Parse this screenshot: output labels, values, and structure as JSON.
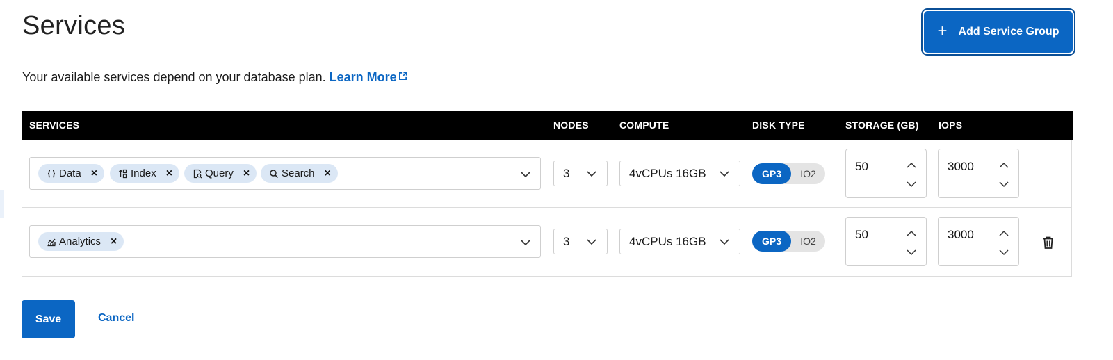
{
  "page": {
    "title": "Services",
    "add_button_label": "Add Service Group",
    "description": "Your available services depend on your database plan.",
    "learn_more_label": "Learn More"
  },
  "table": {
    "headers": {
      "services": "SERVICES",
      "nodes": "NODES",
      "compute": "COMPUTE",
      "disk_type": "DISK TYPE",
      "storage": "STORAGE (GB)",
      "iops": "IOPS"
    },
    "rows": [
      {
        "services": [
          {
            "label": "Data",
            "icon": "braces-icon"
          },
          {
            "label": "Index",
            "icon": "index-sort-icon"
          },
          {
            "label": "Query",
            "icon": "query-document-icon"
          },
          {
            "label": "Search",
            "icon": "search-icon"
          }
        ],
        "nodes": "3",
        "compute": "4vCPUs 16GB",
        "disk_type_options": [
          "GP3",
          "IO2"
        ],
        "disk_type_selected": "GP3",
        "storage": "50",
        "iops": "3000"
      },
      {
        "services": [
          {
            "label": "Analytics",
            "icon": "analytics-chart-icon"
          }
        ],
        "nodes": "3",
        "compute": "4vCPUs 16GB",
        "disk_type_options": [
          "GP3",
          "IO2"
        ],
        "disk_type_selected": "GP3",
        "storage": "50",
        "iops": "3000",
        "deletable": true
      }
    ]
  },
  "actions": {
    "save_label": "Save",
    "cancel_label": "Cancel"
  },
  "colors": {
    "accent": "#0b66c3",
    "header_bg": "#000000",
    "chip_bg": "#dbe7f5",
    "toggle_off_bg": "#e4e4e4"
  }
}
